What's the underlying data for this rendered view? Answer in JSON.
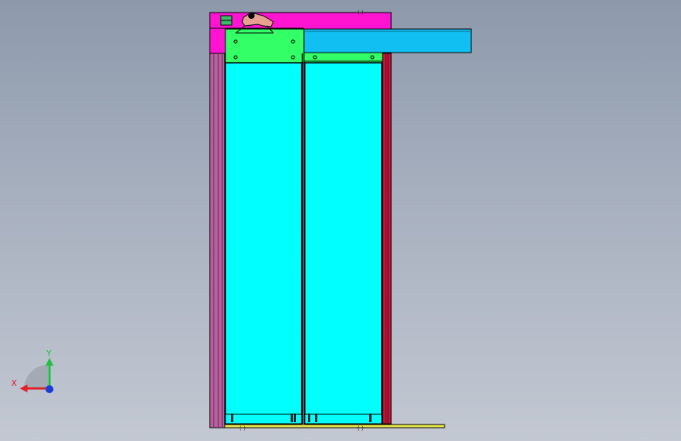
{
  "viewport": {
    "background_top": "#8d99ab",
    "background_bottom": "#c3c8d2"
  },
  "model": {
    "parts": [
      {
        "name": "top-frame-beam",
        "color": "#ff14d2"
      },
      {
        "name": "left-vertical-post",
        "color": "#b9609f"
      },
      {
        "name": "right-vertical-post",
        "color": "#c8173c"
      },
      {
        "name": "cantilever-rail",
        "color": "#12bff2"
      },
      {
        "name": "head-block",
        "color": "#33ff66"
      },
      {
        "name": "left-door-panel",
        "color": "#00ffff"
      },
      {
        "name": "right-door-panel",
        "color": "#00ffff"
      },
      {
        "name": "base-plate",
        "color": "#e8e84a"
      },
      {
        "name": "motor-bracket",
        "color": "#e8a090"
      },
      {
        "name": "motor",
        "color": "#3dbb6a"
      }
    ]
  },
  "triad": {
    "x_label": "X",
    "y_label": "Y",
    "x_color": "#e0202a",
    "y_color": "#20c040",
    "z_color": "#1a3cd8"
  }
}
